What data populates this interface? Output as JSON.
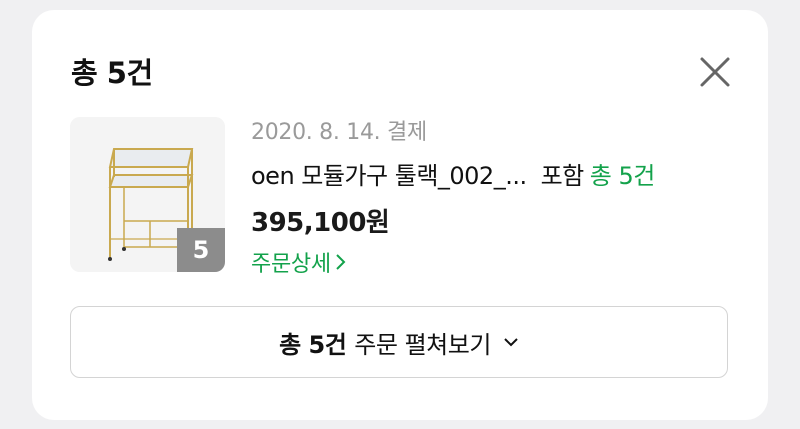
{
  "header": {
    "title": "총 5건"
  },
  "icons": {
    "close": "close-icon",
    "chevron_right": "chevron-right-icon",
    "chevron_down": "chevron-down-icon"
  },
  "order": {
    "date": "2020. 8. 14. 결제",
    "product_name": "oen 모듈가구 툴랙_002_...",
    "included_label": "포함",
    "total_label": "총 5건",
    "price": "395,100원",
    "item_count": "5",
    "detail_link": "주문상세"
  },
  "expand": {
    "bold_label": "총 5건",
    "label": "주문 펼쳐보기"
  },
  "colors": {
    "accent_green": "#13a24b",
    "badge_gray": "#8c8c8c"
  }
}
